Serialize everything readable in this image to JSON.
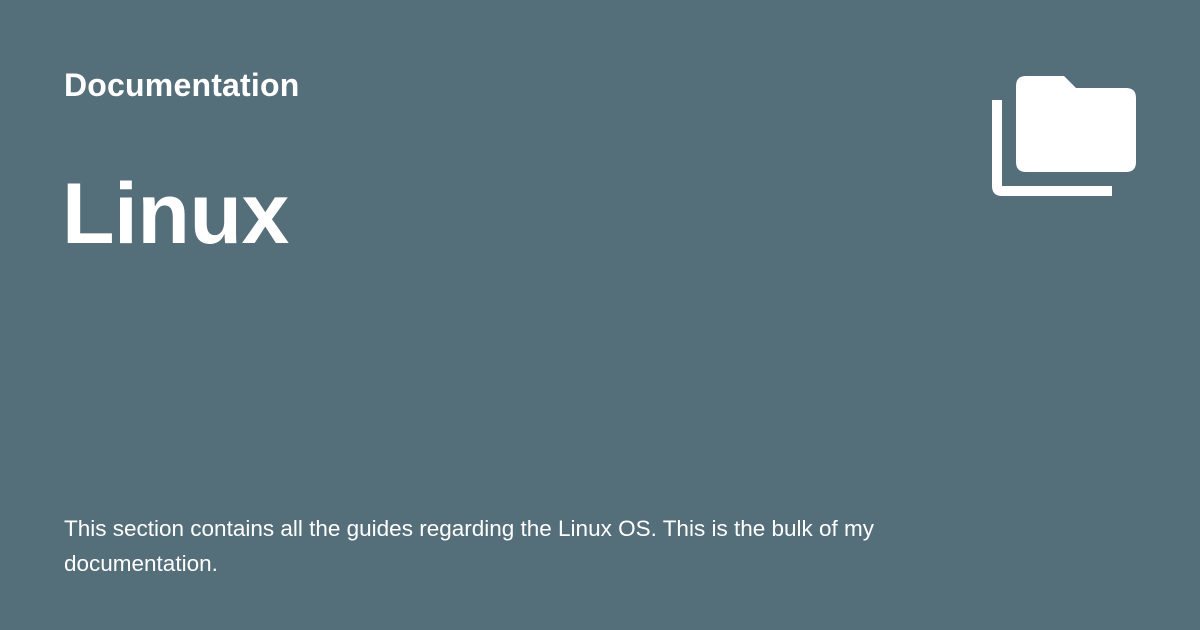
{
  "site": {
    "name": "Documentation"
  },
  "page": {
    "title": "Linux",
    "description": "This section contains all the guides regarding the Linux OS. This is the bulk of my documentation."
  },
  "logo": {
    "icon": "folder-multiple-icon"
  },
  "colors": {
    "background": "#546e7a",
    "foreground": "#ffffff"
  }
}
